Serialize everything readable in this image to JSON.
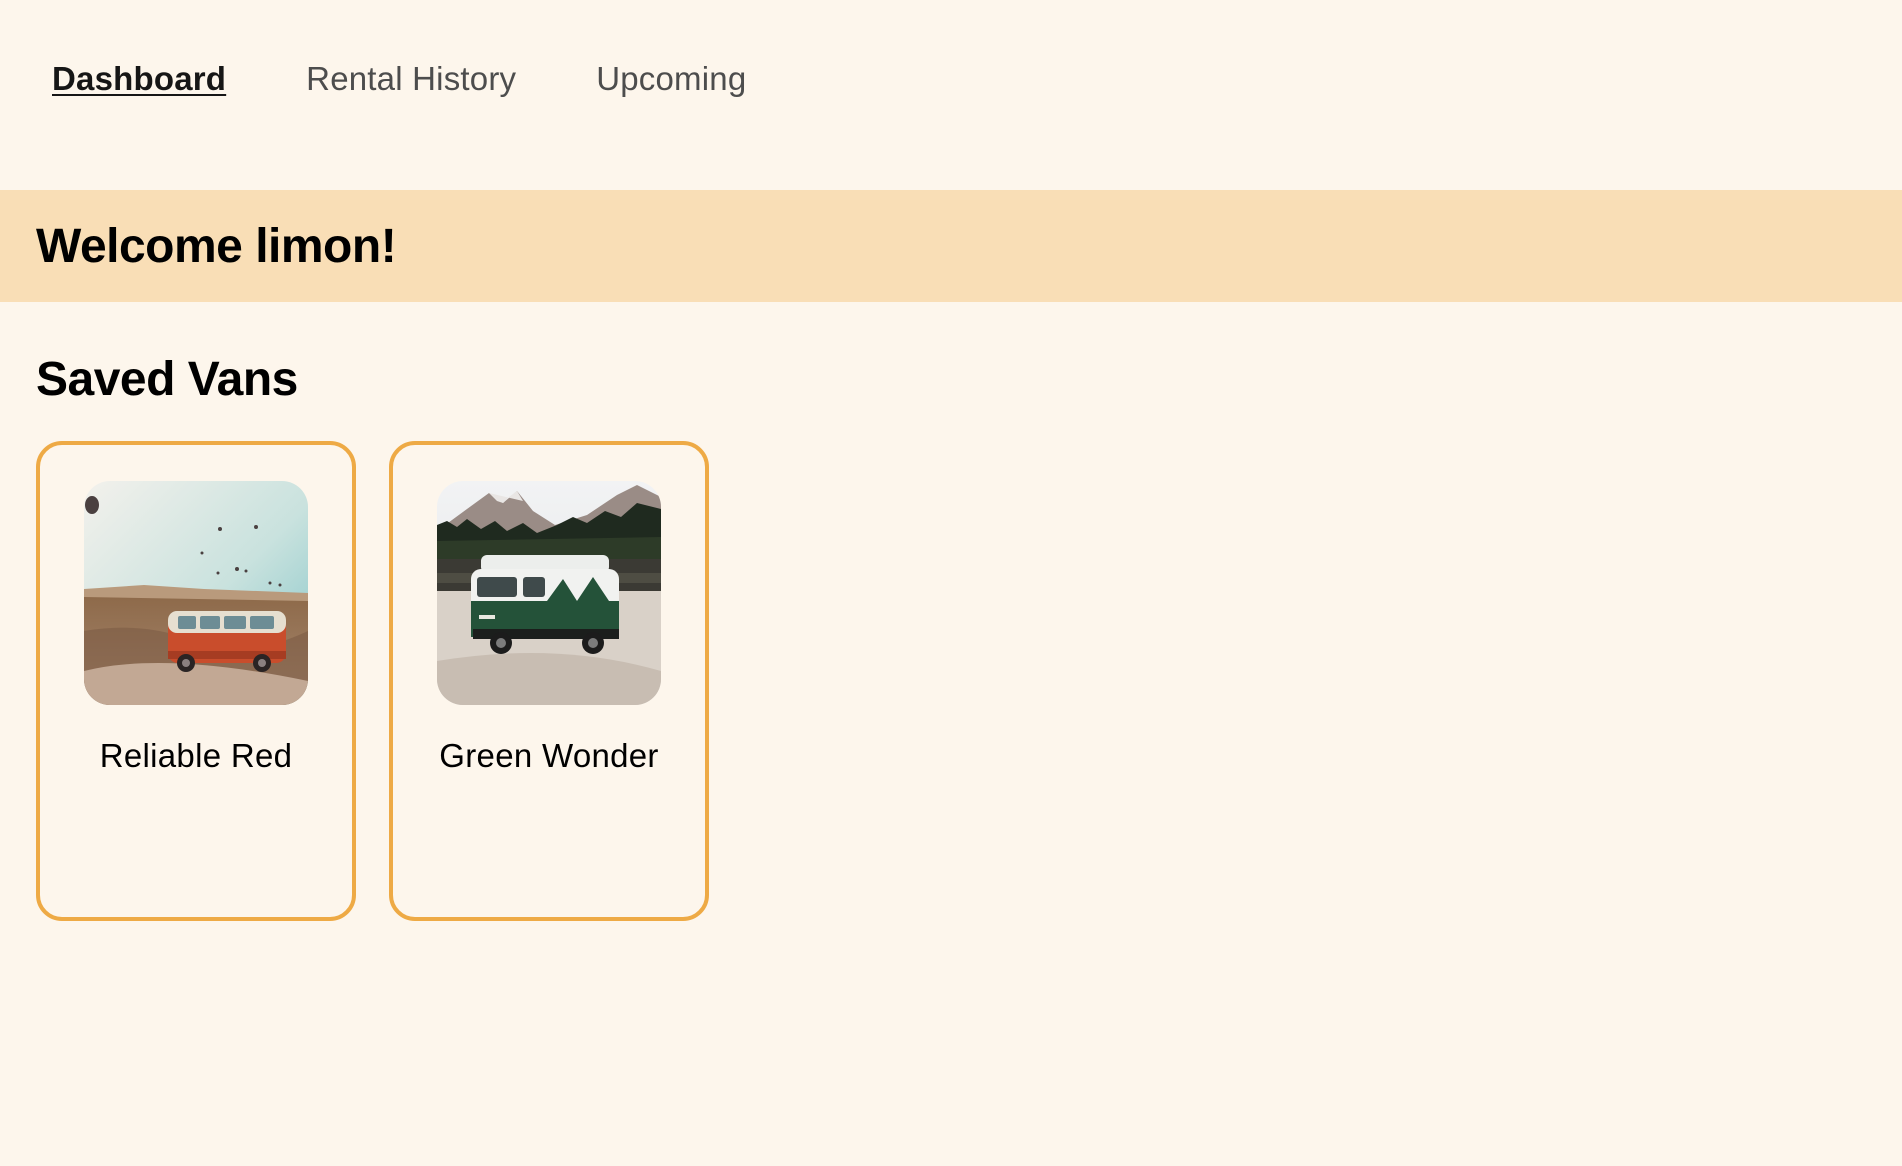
{
  "nav": {
    "items": [
      {
        "label": "Dashboard",
        "active": true
      },
      {
        "label": "Rental History",
        "active": false
      },
      {
        "label": "Upcoming",
        "active": false
      }
    ]
  },
  "banner": {
    "title": "Welcome limon!",
    "color": "#f9deb6"
  },
  "saved": {
    "title": "Saved Vans",
    "vans": [
      {
        "name": "Reliable Red",
        "image": "red-van-photo"
      },
      {
        "name": "Green Wonder",
        "image": "green-van-photo"
      }
    ]
  },
  "colors": {
    "background": "#fdf6ec",
    "card_border": "#eeaa45"
  }
}
